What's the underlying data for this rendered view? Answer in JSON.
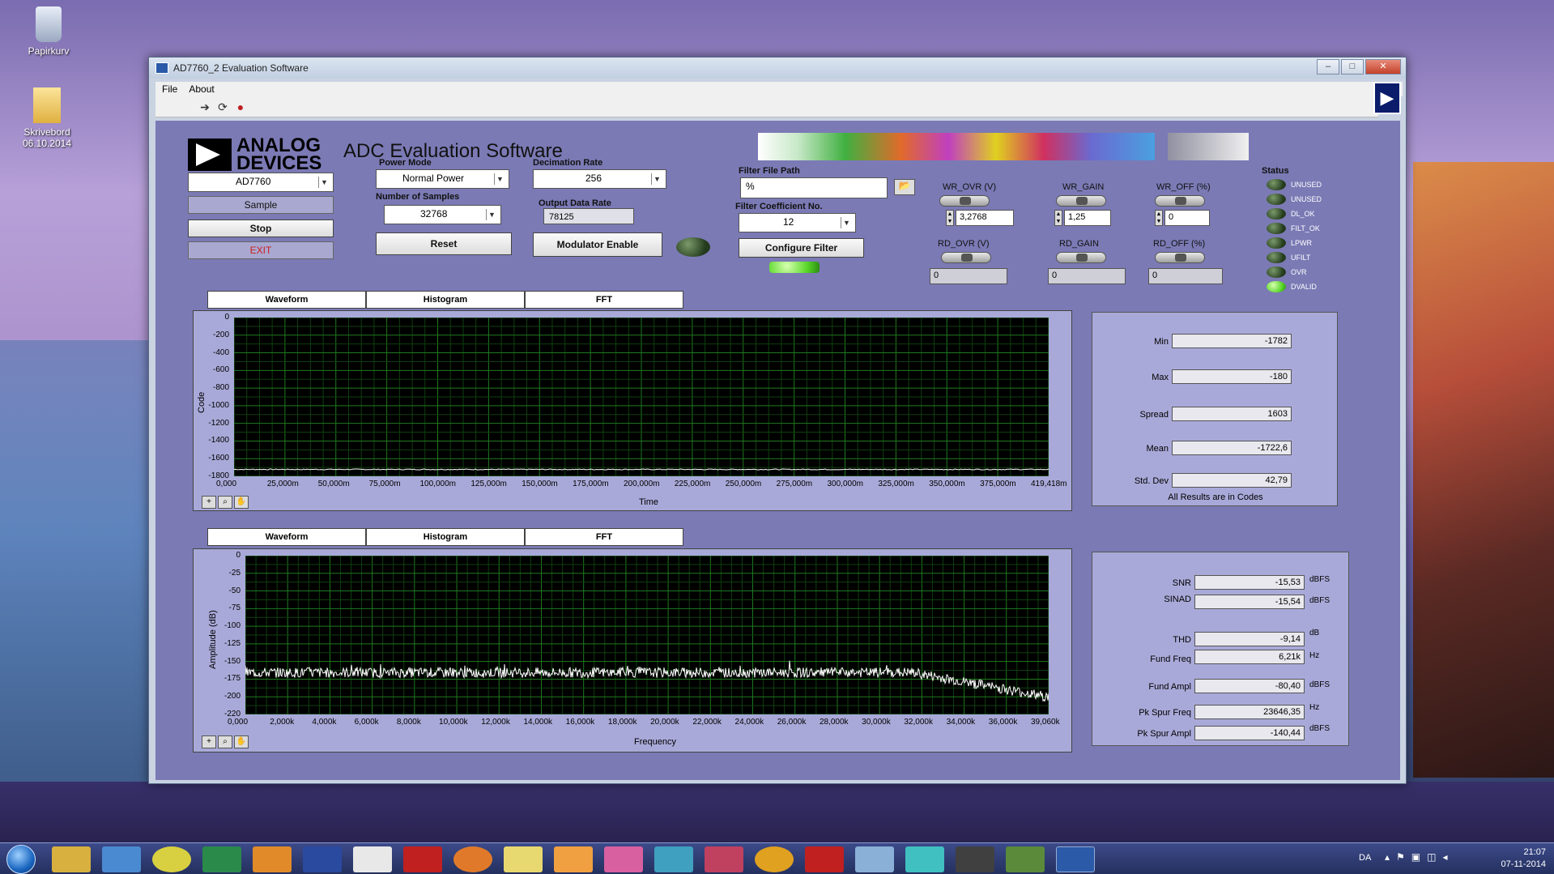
{
  "desktop": {
    "icons": [
      {
        "label": "Papirkurv"
      },
      {
        "label": "Skrivebord 06.10.2014"
      }
    ]
  },
  "window": {
    "title": "AD7760_2 Evaluation Software",
    "min": "–",
    "max": "□",
    "close": "✕"
  },
  "menu": {
    "file": "File",
    "about": "About"
  },
  "toolbar": {
    "arrow": "➔",
    "loop": "⟳",
    "stop": "●",
    "run": "▶"
  },
  "header": {
    "logo_line1": "ANALOG",
    "logo_line2": "DEVICES",
    "app_title": "ADC Evaluation Software"
  },
  "controls": {
    "device": "AD7760",
    "sample_label": "Sample",
    "stop_label": "Stop",
    "exit_label": "EXIT",
    "power_mode_label": "Power Mode",
    "power_mode": "Normal Power",
    "num_samples_label": "Number of Samples",
    "num_samples": "32768",
    "reset_label": "Reset",
    "decimation_label": "Decimation Rate",
    "decimation": "256",
    "odr_label": "Output Data Rate",
    "odr": "78125",
    "modulator_label": "Modulator Enable",
    "filter_path_label": "Filter File Path",
    "filter_path": "%",
    "filter_coef_label": "Filter Coefficient No.",
    "filter_coef": "12",
    "configure_label": "Configure Filter",
    "folder_icon": "folder-icon"
  },
  "registers": {
    "wr_ovr_label": "WR_OVR (V)",
    "wr_ovr": "3,2768",
    "wr_gain_label": "WR_GAIN",
    "wr_gain": "1,25",
    "wr_off_label": "WR_OFF (%)",
    "wr_off": "0",
    "rd_ovr_label": "RD_OVR (V)",
    "rd_ovr": "0",
    "rd_gain_label": "RD_GAIN",
    "rd_gain": "0",
    "rd_off_label": "RD_OFF (%)",
    "rd_off": "0"
  },
  "status": {
    "label": "Status",
    "items": [
      {
        "label": "UNUSED",
        "on": false
      },
      {
        "label": "UNUSED",
        "on": false
      },
      {
        "label": "DL_OK",
        "on": false
      },
      {
        "label": "FILT_OK",
        "on": false
      },
      {
        "label": "LPWR",
        "on": false
      },
      {
        "label": "UFILT",
        "on": false
      },
      {
        "label": "OVR",
        "on": false
      },
      {
        "label": "DVALID",
        "on": true
      }
    ]
  },
  "tabs_top": [
    "Waveform",
    "Histogram",
    "FFT"
  ],
  "tabs_bottom": [
    "Waveform",
    "Histogram",
    "FFT"
  ],
  "waveform": {
    "ylabel": "Code",
    "xlabel": "Time",
    "yticks": [
      "0",
      "-200",
      "-400",
      "-600",
      "-800",
      "-1000",
      "-1200",
      "-1400",
      "-1600",
      "-1800"
    ],
    "xticks": [
      "0,000",
      "25,000m",
      "50,000m",
      "75,000m",
      "100,000m",
      "125,000m",
      "150,000m",
      "175,000m",
      "200,000m",
      "225,000m",
      "250,000m",
      "275,000m",
      "300,000m",
      "325,000m",
      "350,000m",
      "375,000m",
      "419,418m"
    ]
  },
  "fft": {
    "ylabel": "Amplitude (dB)",
    "xlabel": "Frequency",
    "yticks": [
      "0",
      "-25",
      "-50",
      "-75",
      "-100",
      "-125",
      "-150",
      "-175",
      "-200",
      "-220"
    ],
    "xticks": [
      "0,000",
      "2,000k",
      "4,000k",
      "6,000k",
      "8,000k",
      "10,000k",
      "12,000k",
      "14,000k",
      "16,000k",
      "18,000k",
      "20,000k",
      "22,000k",
      "24,000k",
      "26,000k",
      "28,000k",
      "30,000k",
      "32,000k",
      "34,000k",
      "36,000k",
      "39,060k"
    ]
  },
  "stats_top": {
    "min_label": "Min",
    "min": "-1782",
    "max_label": "Max",
    "max": "-180",
    "spread_label": "Spread",
    "spread": "1603",
    "mean_label": "Mean",
    "mean": "-1722,6",
    "std_label": "Std. Dev",
    "std": "42,79",
    "note": "All Results are in Codes"
  },
  "stats_bottom": {
    "snr_label": "SNR",
    "snr": "-15,53",
    "snr_unit": "dBFS",
    "sinad_label": "SINAD",
    "sinad": "-15,54",
    "sinad_unit": "dBFS",
    "thd_label": "THD",
    "thd": "-9,14",
    "thd_unit": "dB",
    "ff_label": "Fund Freq",
    "ff": "6,21k",
    "ff_unit": "Hz",
    "fa_label": "Fund Ampl",
    "fa": "-80,40",
    "fa_unit": "dBFS",
    "psf_label": "Pk Spur Freq",
    "psf": "23646,35",
    "psf_unit": "Hz",
    "psa_label": "Pk Spur Ampl",
    "psa": "-140,44",
    "psa_unit": "dBFS"
  },
  "palette": {
    "cross": "+",
    "zoom": "⌕",
    "hand": "✋"
  },
  "taskbar": {
    "lang": "DA",
    "time": "21:07",
    "date": "07-11-2014"
  }
}
